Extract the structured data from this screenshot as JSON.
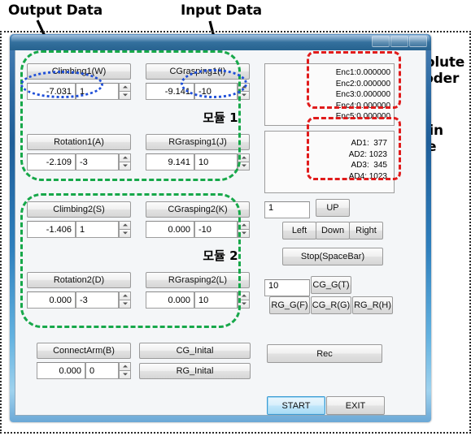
{
  "annotations": {
    "output_data": "Output Data",
    "input_data": "Input Data",
    "absolute_encoder": "Absolute\nEncoder",
    "strain_gage": "Strain\nGage",
    "colors": {
      "output_highlight": "#1f4fd8",
      "input_highlight": "#1f4fd8",
      "module_group": "#17a84a",
      "sensor_group": "#e01b1b",
      "arrow": "#000000"
    }
  },
  "window": {
    "title": "",
    "buttons": [
      "minimize",
      "maximize",
      "close"
    ]
  },
  "modules": [
    {
      "title": "모듈 1",
      "axes": [
        {
          "button": "Climbing1(W)",
          "output": "-7.031",
          "input": "1"
        },
        {
          "button": "CGrasping1(I)",
          "output": "-9.141",
          "input": "-10"
        },
        {
          "button": "Rotation1(A)",
          "output": "-2.109",
          "input": "-3"
        },
        {
          "button": "RGrasping1(J)",
          "output": "9.141",
          "input": "10"
        }
      ]
    },
    {
      "title": "모듈 2",
      "axes": [
        {
          "button": "Climbing2(S)",
          "output": "-1.406",
          "input": "1"
        },
        {
          "button": "CGrasping2(K)",
          "output": "0.000",
          "input": "-10"
        },
        {
          "button": "Rotation2(D)",
          "output": "0.000",
          "input": "-3"
        },
        {
          "button": "RGrasping2(L)",
          "output": "0.000",
          "input": "10"
        }
      ]
    }
  ],
  "connect_arm": {
    "button": "ConnectArm(B)",
    "output": "0.000",
    "input": "0"
  },
  "initial_buttons": {
    "cg": "CG_Inital",
    "rg": "RG_Inital"
  },
  "encoder_panel": {
    "lines": "Enc1:0.000000\nEnc2:0.000000\nEnc3:0.000000\nEnc4:0.000000\nEnc5:0.000000",
    "values": [
      {
        "label": "Enc1",
        "value": "0.000000"
      },
      {
        "label": "Enc2",
        "value": "0.000000"
      },
      {
        "label": "Enc3",
        "value": "0.000000"
      },
      {
        "label": "Enc4",
        "value": "0.000000"
      },
      {
        "label": "Enc5",
        "value": "0.000000"
      }
    ]
  },
  "strain_panel": {
    "lines": "AD1:  377\nAD2: 1023\nAD3:  345\nAD4: 1023",
    "values": [
      {
        "label": "AD1",
        "value": "377"
      },
      {
        "label": "AD2",
        "value": "1023"
      },
      {
        "label": "AD3",
        "value": "345"
      },
      {
        "label": "AD4",
        "value": "1023"
      }
    ]
  },
  "jog_panel": {
    "step_value": "1",
    "up": "UP",
    "left": "Left",
    "down": "Down",
    "right": "Right",
    "stop": "Stop(SpaceBar)"
  },
  "grasp_panel": {
    "step_value": "10",
    "cg_g": "CG_G(T)",
    "rg_g": "RG_G(F)",
    "cg_r": "CG_R(G)",
    "rg_r": "RG_R(H)"
  },
  "bottom": {
    "rec": "Rec",
    "start": "START",
    "exit": "EXIT"
  }
}
